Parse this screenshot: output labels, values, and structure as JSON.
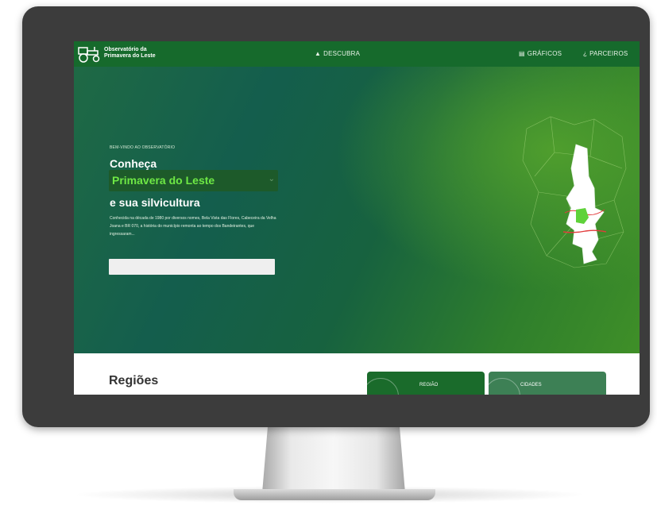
{
  "brand": {
    "name_line1": "Observatório da",
    "name_line2": "Primavera do Leste"
  },
  "nav": {
    "items": [
      {
        "icon": "mountain-icon",
        "label": "DESCUBRA"
      },
      {
        "icon": "chart-icon",
        "label": "GRÁFICOS"
      },
      {
        "icon": "handshake-icon",
        "label": "PARCEIROS"
      }
    ]
  },
  "hero": {
    "kicker": "BEM-VINDO AO OBSERVATÓRIO",
    "headline_top": "Conheça",
    "headline_select": "Primavera do Leste",
    "headline_bottom": "e sua silvicultura",
    "description": "Conhecida na década de 1980 por diversos nomes, Bela Vista das Flores, Cabeceira da Velha Joana e BR 070, a história do município remonta ao tempo dos Bandeirantes, que ingressaram...",
    "search_value": ""
  },
  "section": {
    "title": "Regiões",
    "cards": [
      {
        "label": "REGIÃO"
      },
      {
        "label": "CIDADES"
      }
    ]
  },
  "colors": {
    "navbar": "#166a2c",
    "accent_green": "#6ee845",
    "card_primary": "#1a6b2b",
    "card_secondary": "#3d8055",
    "bezel": "#3c3c3c"
  }
}
